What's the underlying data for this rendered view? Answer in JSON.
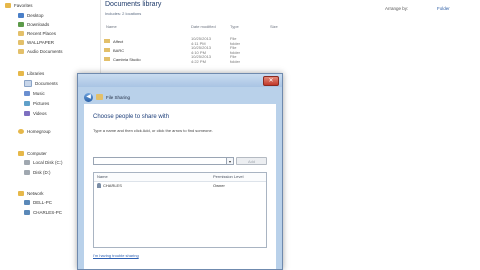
{
  "nav": {
    "favorites": "Favorites",
    "items_fav": [
      "Desktop",
      "Downloads",
      "Recent Places",
      "WALLPAPER",
      "Audio Documents"
    ],
    "libraries": "Libraries",
    "items_lib": [
      "Documents",
      "Music",
      "Pictures",
      "Videos"
    ],
    "homegroup": "Homegroup",
    "computer": "Computer",
    "items_comp": [
      "Local Disk (C:)",
      "Disk (D:)"
    ],
    "network": "Network",
    "items_net": [
      "DELL-PC",
      "CHARLES-PC"
    ]
  },
  "library": {
    "title": "Documents library",
    "subtitle": "Includes: 2 locations",
    "arrange_label": "Arrange by:",
    "arrange_value": "Folder",
    "columns": [
      "Name",
      "Date modified",
      "Type",
      "Size"
    ],
    "files": [
      {
        "name": "Affect",
        "date": "10/25/2013 4:11 PM",
        "type": "File folder"
      },
      {
        "name": "BARC",
        "date": "10/25/2013 4:10 PM",
        "type": "File folder"
      },
      {
        "name": "Cambria Studio",
        "date": "10/25/2013 4:22 PM",
        "type": "File folder"
      }
    ]
  },
  "dialog": {
    "window_title": "File Sharing",
    "heading": "Choose people to share with",
    "instructions": "Type a name and then click Add, or click the arrow to find someone.",
    "input_value": "",
    "add_label": "Add",
    "dropdown_glyph": "▾",
    "close_glyph": "✕",
    "back_glyph": "◀",
    "table": {
      "col_name": "Name",
      "col_perm": "Permission Level",
      "rows": [
        {
          "name": "CHARLES",
          "permission": "Owner"
        }
      ]
    },
    "trouble_link": "I'm having trouble sharing"
  }
}
